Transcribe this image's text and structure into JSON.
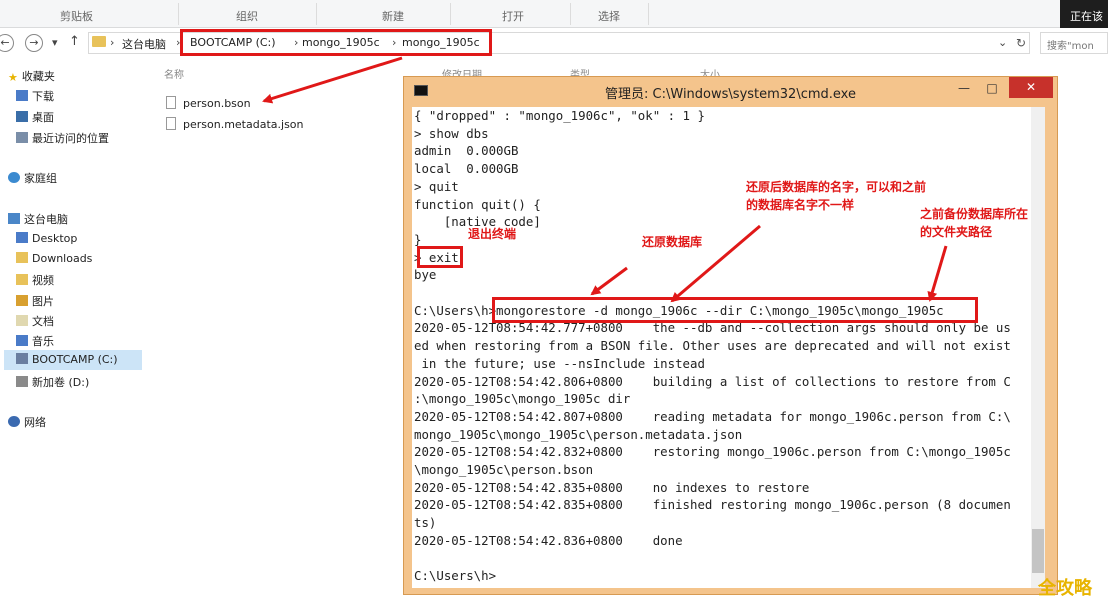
{
  "ribbon": {
    "groups": [
      "剪贴板",
      "组织",
      "新建",
      "打开",
      "选择"
    ],
    "status": "正在该"
  },
  "address": {
    "root": "这台电脑",
    "crumbs": [
      "BOOTCAMP (C:)",
      "mongo_1905c",
      "mongo_1905c"
    ],
    "search_placeholder": "搜索\"mon"
  },
  "sidebar": {
    "items": [
      {
        "label": "收藏夹",
        "icon": "star-icon"
      },
      {
        "label": "下载",
        "icon": "download-folder-icon"
      },
      {
        "label": "桌面",
        "icon": "desktop-icon"
      },
      {
        "label": "最近访问的位置",
        "icon": "recent-icon"
      },
      {
        "label": "家庭组",
        "icon": "homegroup-icon"
      },
      {
        "label": "这台电脑",
        "icon": "computer-icon"
      },
      {
        "label": "Desktop",
        "icon": "folder-icon"
      },
      {
        "label": "Downloads",
        "icon": "folder-icon"
      },
      {
        "label": "视频",
        "icon": "video-icon"
      },
      {
        "label": "图片",
        "icon": "picture-icon"
      },
      {
        "label": "文档",
        "icon": "document-icon"
      },
      {
        "label": "音乐",
        "icon": "music-icon"
      },
      {
        "label": "BOOTCAMP (C:)",
        "icon": "drive-icon"
      },
      {
        "label": "新加卷 (D:)",
        "icon": "drive-icon"
      },
      {
        "label": "网络",
        "icon": "network-icon"
      }
    ]
  },
  "filelist": {
    "header_name": "名称",
    "header_date": "修改日期",
    "header_type": "类型",
    "header_size": "大小",
    "files": [
      "person.bson",
      "person.metadata.json"
    ]
  },
  "cmd": {
    "title": "管理员: C:\\Windows\\system32\\cmd.exe",
    "min": "—",
    "max": "□",
    "close": "✕",
    "lines": [
      "{ \"dropped\" : \"mongo_1906c\", \"ok\" : 1 }",
      "> show dbs",
      "admin  0.000GB",
      "local  0.000GB",
      "> quit",
      "function quit() {",
      "    [native code]",
      "}",
      "> exit",
      "bye",
      "",
      "C:\\Users\\h>mongorestore -d mongo_1906c --dir C:\\mongo_1905c\\mongo_1905c",
      "2020-05-12T08:54:42.777+0800    the --db and --collection args should only be us",
      "ed when restoring from a BSON file. Other uses are deprecated and will not exist",
      " in the future; use --nsInclude instead",
      "2020-05-12T08:54:42.806+0800    building a list of collections to restore from C",
      ":\\mongo_1905c\\mongo_1905c dir",
      "2020-05-12T08:54:42.807+0800    reading metadata for mongo_1906c.person from C:\\",
      "mongo_1905c\\mongo_1905c\\person.metadata.json",
      "2020-05-12T08:54:42.832+0800    restoring mongo_1906c.person from C:\\mongo_1905c",
      "\\mongo_1905c\\person.bson",
      "2020-05-12T08:54:42.835+0800    no indexes to restore",
      "2020-05-12T08:54:42.835+0800    finished restoring mongo_1906c.person (8 documen",
      "ts)",
      "2020-05-12T08:54:42.836+0800    done",
      "",
      "C:\\Users\\h>"
    ]
  },
  "annotations": {
    "exit": "退出终端",
    "restore": "还原数据库",
    "name_line1": "还原后数据库的名字，可以和之前",
    "name_line2": "的数据库名字不一样",
    "path_line1": "之前备份数据库所在",
    "path_line2": "的文件夹路径"
  },
  "watermark": "全攻略",
  "colors": {
    "annotation_red": "#e01818",
    "cmd_frame": "#f4c48c",
    "close_red": "#c7312b",
    "selection": "#cce4f7"
  }
}
